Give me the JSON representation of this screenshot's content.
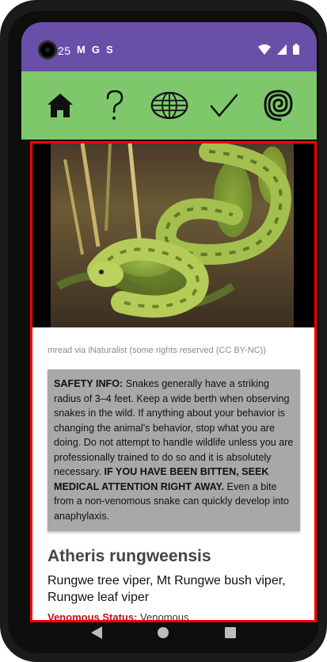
{
  "status_bar": {
    "time": "25",
    "notifications": [
      "M",
      "G",
      "S"
    ]
  },
  "nav": {
    "items": [
      {
        "name": "home",
        "icon": "home-icon"
      },
      {
        "name": "help",
        "icon": "question-icon"
      },
      {
        "name": "globe",
        "icon": "globe-icon"
      },
      {
        "name": "check",
        "icon": "check-icon"
      },
      {
        "name": "spiral",
        "icon": "spiral-icon"
      }
    ]
  },
  "photo": {
    "credit": "mread via iNaturalist (some rights reserved (CC BY-NC))"
  },
  "safety": {
    "label": "SAFETY INFO:",
    "text1": " Snakes generally have a striking radius of 3–4 feet. Keep a wide berth when observing snakes in the wild. If anything about your behavior is changing the animal's behavior, stop what you are doing. Do not attempt to handle wildlife unless you are professionally trained to do so and it is absolutely necessary. ",
    "warning": "IF YOU HAVE BEEN BITTEN, SEEK MEDICAL ATTENTION RIGHT AWAY.",
    "text2": " Even a bite from a non-venomous snake can quickly develop into anaphylaxis."
  },
  "species": {
    "scientific_name": "Atheris rungweensis",
    "common_names": "Rungwe tree viper, Mt Rungwe bush viper, Rungwe leaf viper",
    "venom_label": "Venomous Status:",
    "venom_value": "Venomous"
  },
  "colors": {
    "status_bar": "#6a4fa8",
    "nav_bar": "#7ec86b",
    "highlight_border": "#ff0000",
    "safety_bg": "#a8a8a8",
    "venom_label": "#c0101a"
  }
}
